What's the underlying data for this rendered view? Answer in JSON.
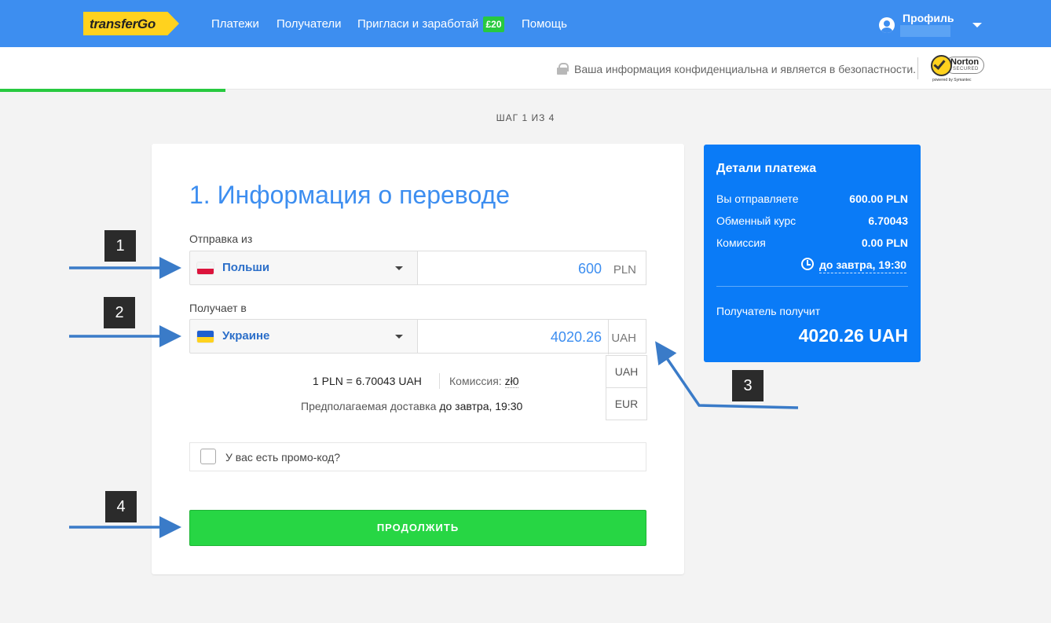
{
  "nav": {
    "logo": "transferGo",
    "items": [
      "Платежи",
      "Получатели",
      "Пригласи и заработай",
      "Помощь"
    ],
    "invite_badge": "£20",
    "profile_label": "Профиль"
  },
  "security": {
    "text": "Ваша информация конфиденциальна и является в безопастности.",
    "norton_name": "Norton",
    "norton_secured": "SECURED",
    "norton_powered": "powered by Symantec"
  },
  "progress": {
    "step": 1,
    "total": 4,
    "fraction": 0.25
  },
  "step_label": "ШАГ 1 ИЗ 4",
  "form": {
    "heading": "1. Информация о переводе",
    "send_from_label": "Отправка из",
    "send_country": "Польши",
    "send_amount": "600",
    "send_currency": "PLN",
    "receive_in_label": "Получает в",
    "receive_country": "Украине",
    "receive_amount": "4020.26",
    "receive_currency": "UAH",
    "currency_options": [
      "UAH",
      "EUR"
    ],
    "rate_text": "1 PLN = 6.70043 UAH",
    "fee_label": "Комиссия:",
    "fee_value": "zł0",
    "delivery_label": "Предполагаемая доставка",
    "delivery_value": "до завтра, 19:30",
    "promo_label": "У вас есть промо-код?",
    "continue_button": "ПРОДОЛЖИТЬ"
  },
  "details": {
    "title": "Детали платежа",
    "rows": [
      {
        "label": "Вы отправляете",
        "value": "600.00 PLN"
      },
      {
        "label": "Обменный курс",
        "value": "6.70043"
      },
      {
        "label": "Комиссия",
        "value": "0.00 PLN"
      }
    ],
    "delivery_time": "до завтра, 19:30",
    "recipient_label": "Получатель получит",
    "recipient_amount": "4020.26 UAH"
  },
  "annotations": [
    "1",
    "2",
    "3",
    "4"
  ],
  "colors": {
    "nav_blue": "#3d8ef0",
    "panel_blue": "#0a7bf7",
    "accent_green": "#27d644",
    "logo_yellow": "#ffd21e"
  }
}
